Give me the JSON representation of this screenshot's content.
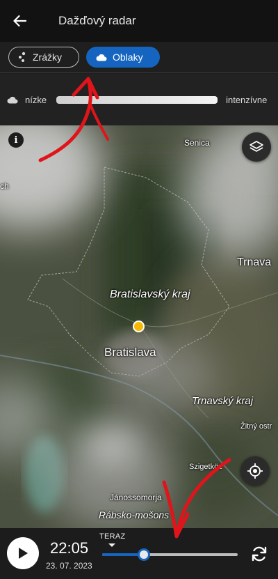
{
  "appbar": {
    "title": "Dažďový radar"
  },
  "tabs": [
    {
      "label": "Zrážky",
      "active": false
    },
    {
      "label": "Oblaky",
      "active": true
    }
  ],
  "legend": {
    "low": "nízke",
    "high": "intenzívne"
  },
  "map": {
    "labels": {
      "senica": "Senica",
      "trnava": "Trnava",
      "bratislavsky_kraj": "Bratislavský kraj",
      "bratislava": "Bratislava",
      "trnavsky_kraj": "Trnavský kraj",
      "zitny_ostrov": "Žitný ostr",
      "szigetkoz": "Szigetköz",
      "janossomorja": "Jánossomorja",
      "rabsko": "Rábsko-mošons",
      "ach": "ch"
    }
  },
  "player": {
    "time": "22:05",
    "date": "23. 07. 2023",
    "now_label": "TERAZ",
    "progress": 0.31
  },
  "colors": {
    "accent": "#1565c0",
    "pin": "#f6b800",
    "annotation": "#e0141b"
  }
}
